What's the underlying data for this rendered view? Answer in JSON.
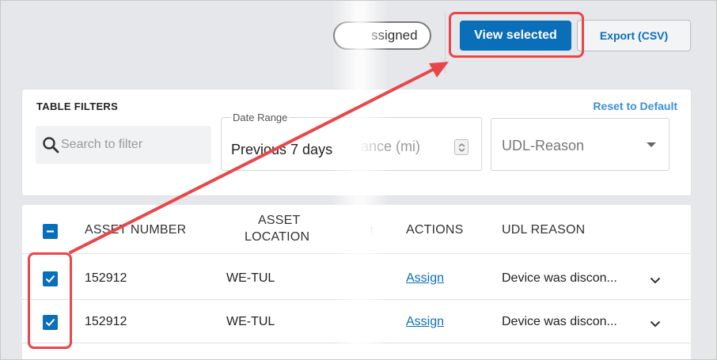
{
  "toolbar": {
    "toggle_partial_label": "ssigned",
    "view_selected_label": "View selected",
    "export_label": "Export (CSV)"
  },
  "filters": {
    "title": "TABLE FILTERS",
    "reset_label": "Reset to Default",
    "search_placeholder": "Search to filter",
    "date_range_label": "Date Range",
    "date_range_value": "Previous 7 days",
    "distance_placeholder_partial": "ance (mi)",
    "udl_reason_placeholder": "UDL-Reason"
  },
  "table": {
    "headers": {
      "asset_number": "ASSET NUMBER",
      "asset_location_line1": "ASSET",
      "asset_location_line2": "LOCATION",
      "actions": "ACTIONS",
      "udl_reason": "UDL REASON"
    },
    "rows": [
      {
        "asset_number": "152912",
        "location": "WE-TUL",
        "action": "Assign",
        "udl_reason": "Device was discon...",
        "checked": true
      },
      {
        "asset_number": "152912",
        "location": "WE-TUL",
        "action": "Assign",
        "udl_reason": "Device was discon...",
        "checked": true
      }
    ]
  },
  "colors": {
    "primary": "#0a6eb8",
    "annotation": "#e8474a",
    "link": "#3d8fd6"
  },
  "icons": [
    "search-icon",
    "stepper-icon",
    "dropdown-caret-icon",
    "minus-checkbox-icon",
    "checkmark-icon",
    "chevron-down-icon",
    "sort-arrow-icon"
  ]
}
